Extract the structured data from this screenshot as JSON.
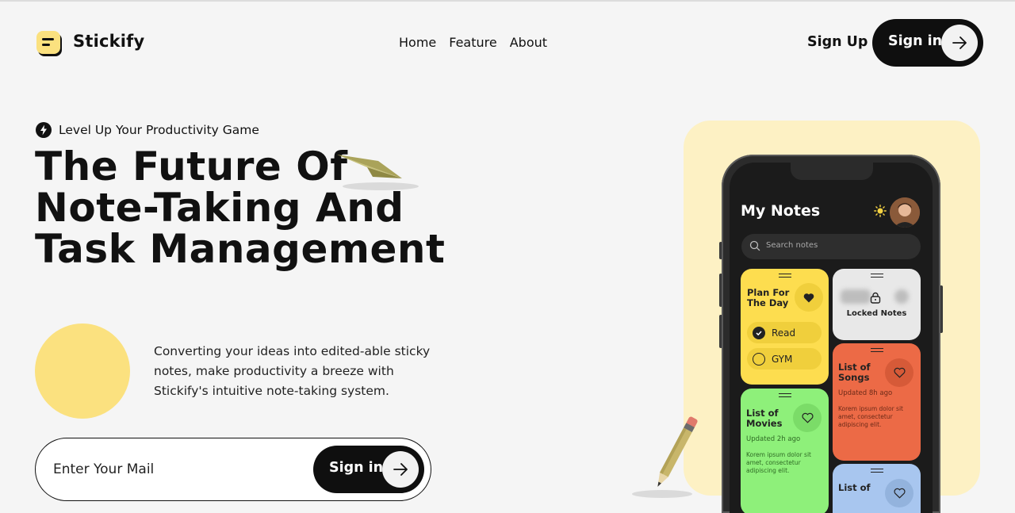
{
  "brand": {
    "name": "Stickify"
  },
  "nav": {
    "items": [
      "Home",
      "Feature",
      "About"
    ]
  },
  "header": {
    "signup_label": "Sign Up",
    "signin_label": "Sign in"
  },
  "hero": {
    "tagline": "Level Up Your Productivity Game",
    "headline_lines": [
      "The Future Of",
      "Note-Taking And",
      "Task Management"
    ],
    "description": "Converting your ideas into edited-able sticky notes, make productivity a breeze with Stickify's intuitive note-taking system.",
    "email_placeholder": "Enter Your Mail",
    "signin_label": "Sign in"
  },
  "phone": {
    "title": "My Notes",
    "search_placeholder": "Search notes",
    "cards": {
      "plan": {
        "title": "Plan For The Day",
        "checklist": [
          {
            "label": "Read",
            "checked": true
          },
          {
            "label": "GYM",
            "checked": false
          }
        ]
      },
      "locked": {
        "title": "Locked Notes"
      },
      "songs": {
        "title": "List of Songs",
        "updated": "Updated 8h ago",
        "body": "Korem ipsum dolor sit amet, consectetur adipiscing elit."
      },
      "movies": {
        "title": "List of Movies",
        "updated": "Updated 2h ago",
        "body": "Korem ipsum dolor sit amet, consectetur adipiscing elit."
      },
      "last": {
        "title": "List of"
      }
    }
  },
  "colors": {
    "background": "#f5f5f5",
    "accent_yellow": "#fbe17f",
    "panel": "#fdf1c4",
    "dark": "#0f0f0f",
    "card_yellow": "#fddd4f",
    "card_orange": "#ec6a46",
    "card_green": "#8ef07a",
    "card_blue": "#a8c6ef"
  },
  "icons": [
    "notes-logo-icon",
    "lightning-icon",
    "arrow-right-icon",
    "paper-plane-icon",
    "pencil-icon",
    "sun-icon",
    "search-icon",
    "heart-icon",
    "lock-icon",
    "check-icon"
  ]
}
